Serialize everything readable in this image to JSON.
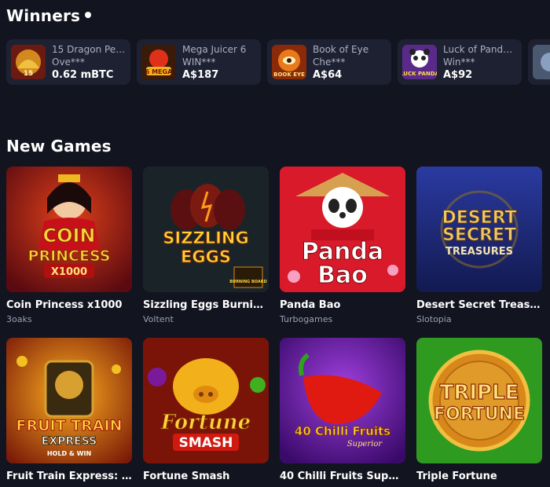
{
  "winners": {
    "title": "Winners",
    "items": [
      {
        "game": "15 Dragon Pe…",
        "user": "Ove***",
        "amount": "0.62 mBTC"
      },
      {
        "game": "Mega Juicer 6",
        "user": "WIN***",
        "amount": "A$187"
      },
      {
        "game": "Book of Eye",
        "user": "Che***",
        "amount": "A$64"
      },
      {
        "game": "Luck of Pand…",
        "user": "Win***",
        "amount": "A$92"
      }
    ]
  },
  "new_games": {
    "title": "New Games",
    "items": [
      {
        "title": "Coin Princess x1000",
        "provider": "3oaks",
        "art_text": [
          "COIN",
          "PRINCESS",
          "X1000"
        ]
      },
      {
        "title": "Sizzling Eggs Burning…",
        "provider": "Voltent",
        "art_text": [
          "SIZZLING",
          "EGGS",
          "BURNING BOARD"
        ]
      },
      {
        "title": "Panda Bao",
        "provider": "Turbogames",
        "art_text": [
          "Panda",
          "Bao"
        ]
      },
      {
        "title": "Desert Secret Treas…",
        "provider": "Slotopia",
        "art_text": [
          "DESERT",
          "SECRET",
          "TREASURES"
        ]
      },
      {
        "title": "Fruit Train Express: …",
        "provider": "",
        "art_text": [
          "FRUIT TRAIN",
          "EXPRESS",
          "HOLD & WIN"
        ]
      },
      {
        "title": "Fortune Smash",
        "provider": "",
        "art_text": [
          "Fortune",
          "SMASH"
        ]
      },
      {
        "title": "40 Chilli Fruits Super…",
        "provider": "",
        "art_text": [
          "40 Chilli Fruits",
          "Superior"
        ]
      },
      {
        "title": "Triple Fortune",
        "provider": "",
        "art_text": [
          "TRIPLE",
          "FORTUNE"
        ]
      }
    ]
  },
  "winner_thumb_art": [
    "15",
    "6 MEGA",
    "BOOK EYE",
    "LUCK PANDA"
  ]
}
